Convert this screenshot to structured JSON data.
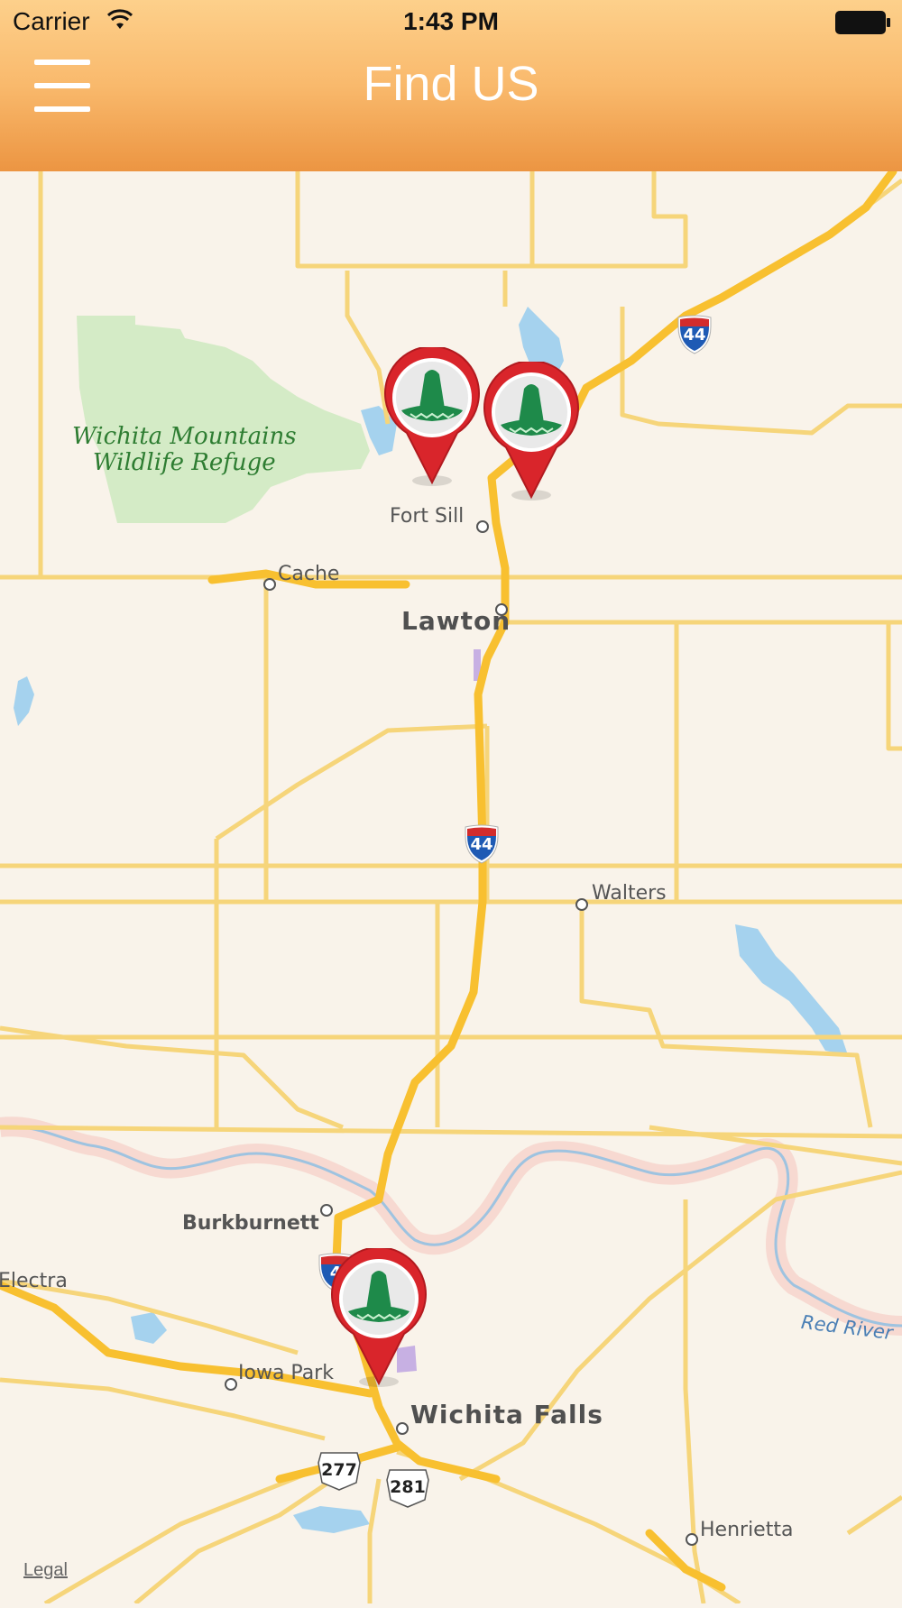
{
  "status_bar": {
    "carrier": "Carrier",
    "time": "1:43 PM"
  },
  "nav": {
    "title": "Find US",
    "menu_icon": "hamburger-menu-icon"
  },
  "map": {
    "park": {
      "line1": "Wichita Mountains",
      "line2": "Wildlife Refuge"
    },
    "cities": {
      "fort_sill": "Fort Sill",
      "cache": "Cache",
      "lawton": "Lawton",
      "walters": "Walters",
      "burkburnett": "Burkburnett",
      "electra": "Electra",
      "iowa_park": "Iowa Park",
      "wichita_falls": "Wichita Falls",
      "henrietta": "Henrietta"
    },
    "river": "Red River",
    "shields": {
      "i44_a": "44",
      "i44_b": "44",
      "i44_c": "4",
      "us277": "277",
      "us281": "281"
    },
    "pins": [
      {
        "name": "sombrero-pin-icon"
      },
      {
        "name": "sombrero-pin-icon"
      },
      {
        "name": "sombrero-pin-icon"
      }
    ],
    "legal": "Legal"
  },
  "colors": {
    "header_top": "#fdd08b",
    "header_bottom": "#ec9542",
    "land": "#f9f3ea",
    "highway": "#f8c030",
    "road": "#f6d57a",
    "water": "#a5d2ee",
    "park": "#d4ebc6",
    "pin_red": "#d9252b",
    "sombrero_green": "#1e8a4a"
  }
}
